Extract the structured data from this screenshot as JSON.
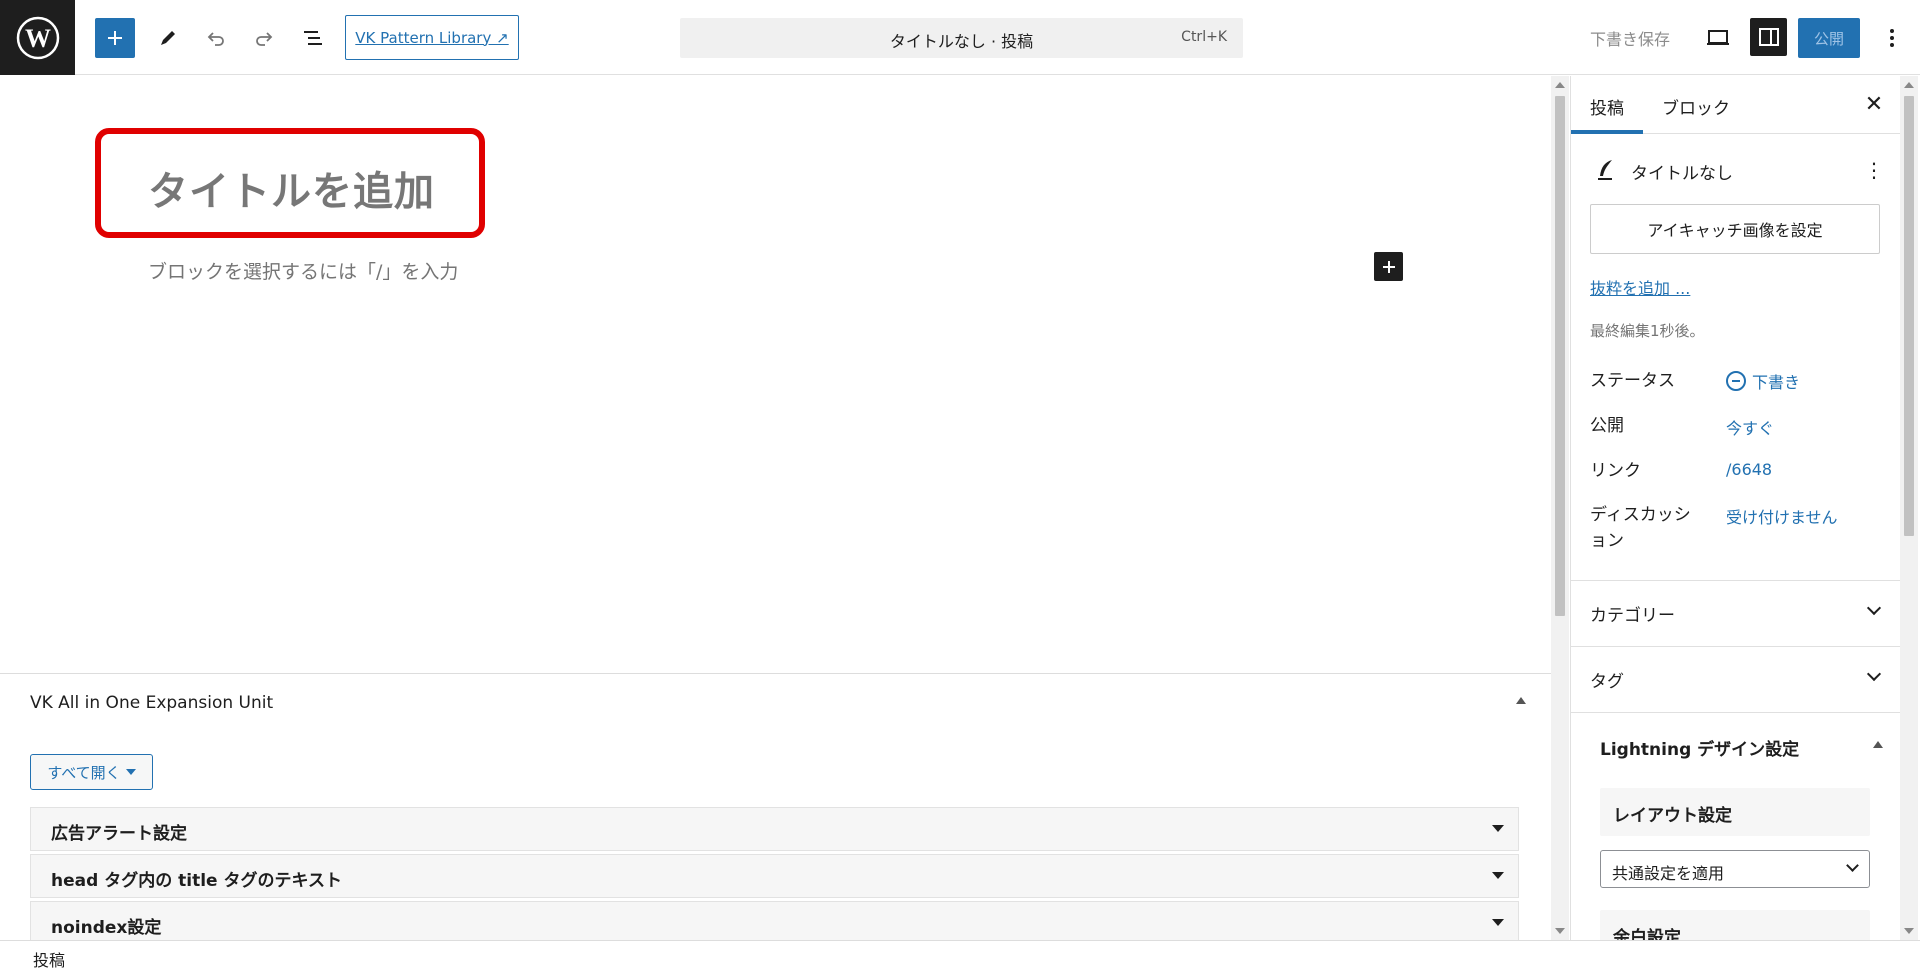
{
  "toolbar": {
    "pattern_library_label": "VK Pattern Library ↗",
    "document_title": "タイトルなし · 投稿",
    "command_shortcut": "Ctrl+K",
    "save_draft_label": "下書き保存",
    "publish_label": "公開"
  },
  "editor": {
    "title_placeholder": "タイトルを追加",
    "block_placeholder": "ブロックを選択するには「/」を入力"
  },
  "metabox": {
    "title": "VK All in One Expansion Unit",
    "open_all_label": "すべて開く",
    "rows": [
      "広告アラート設定",
      "head タグ内の title タグのテキスト",
      "noindex設定"
    ]
  },
  "footer": {
    "breadcrumb": "投稿"
  },
  "sidebar": {
    "tabs": [
      "投稿",
      "ブロック"
    ],
    "active_tab": "投稿",
    "post_title": "タイトルなし",
    "featured_image_button": "アイキャッチ画像を設定",
    "excerpt_link": "抜粋を追加 ...",
    "last_edited": "最終編集1秒後。",
    "props": [
      {
        "label": "ステータス",
        "value": "下書き"
      },
      {
        "label": "公開",
        "value": "今すぐ"
      },
      {
        "label": "リンク",
        "value": "/6648"
      },
      {
        "label": "ディスカッション",
        "value": "受け付けません"
      }
    ],
    "panels": [
      "カテゴリー",
      "タグ"
    ],
    "lightning_title": "Lightning デザイン設定",
    "layout_title": "レイアウト設定",
    "layout_select_value": "共通設定を適用",
    "next_card_title": "余白設定"
  },
  "colors": {
    "accent": "#2271b1",
    "highlight_box": "#e00000",
    "dark": "#1e1e1e"
  }
}
